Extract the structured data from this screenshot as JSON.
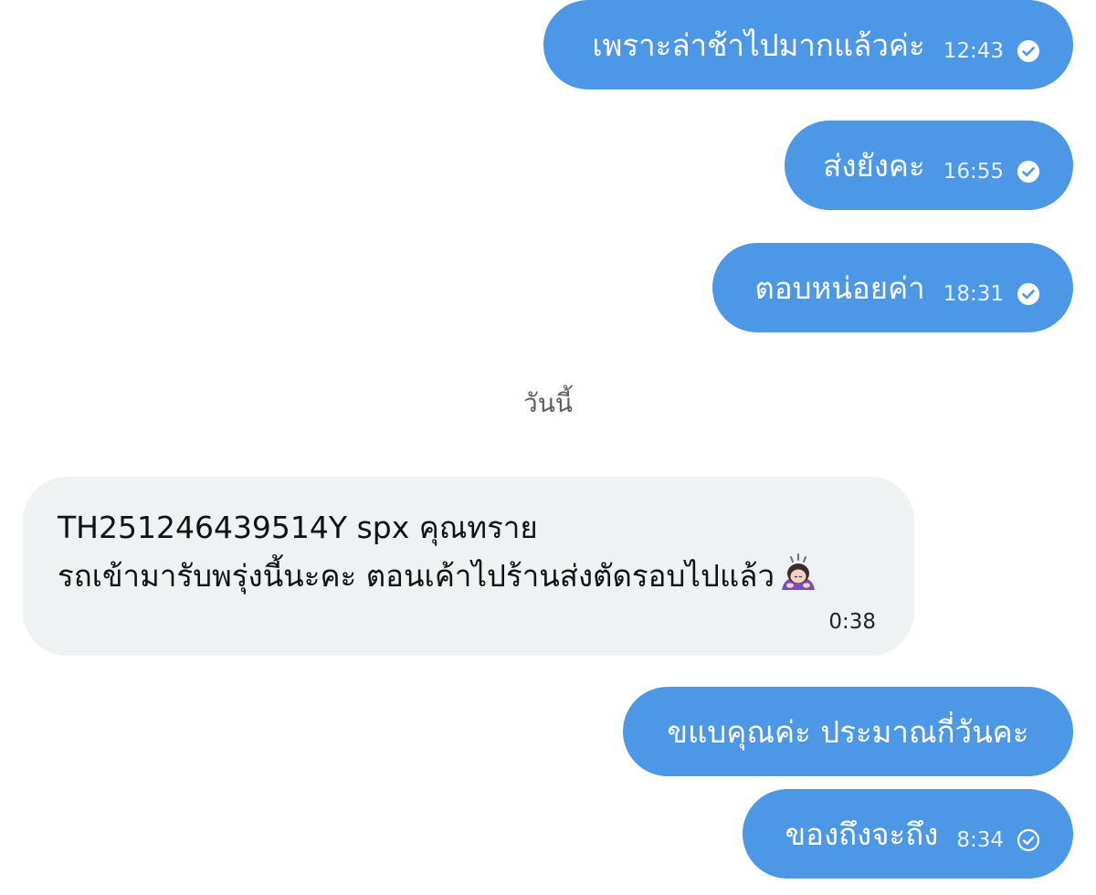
{
  "messages": [
    {
      "text": "เพราะล่าช้าไปมากแล้วค่ะ",
      "time": "12:43",
      "status": "read-check-filled"
    },
    {
      "text": "ส่งยังคะ",
      "time": "16:55",
      "status": "read-check-filled"
    },
    {
      "text": "ตอบหน่อยค่า",
      "time": "18:31",
      "status": "read-check-filled"
    },
    {
      "date_separator": "วันนี้"
    },
    {
      "lines": [
        "TH251246439514Y spx คุณทราย",
        "รถเข้ามารับพรุ่งนี้นะคะ ตอนเค้าไปร้านส่งตัดรอบไปแล้ว"
      ],
      "emoji": "bowing-woman-emoji",
      "time": "0:38"
    },
    {
      "text": "ขแบคุณค่ะ ประมาณกี่วันคะ"
    },
    {
      "text": "ของถึงจะถึง",
      "time": "8:34",
      "status": "sent-check-outline"
    }
  ],
  "colors": {
    "outgoing_bubble": "#4c97e6",
    "incoming_bubble": "#eff2f3",
    "background": "#ffffff"
  }
}
